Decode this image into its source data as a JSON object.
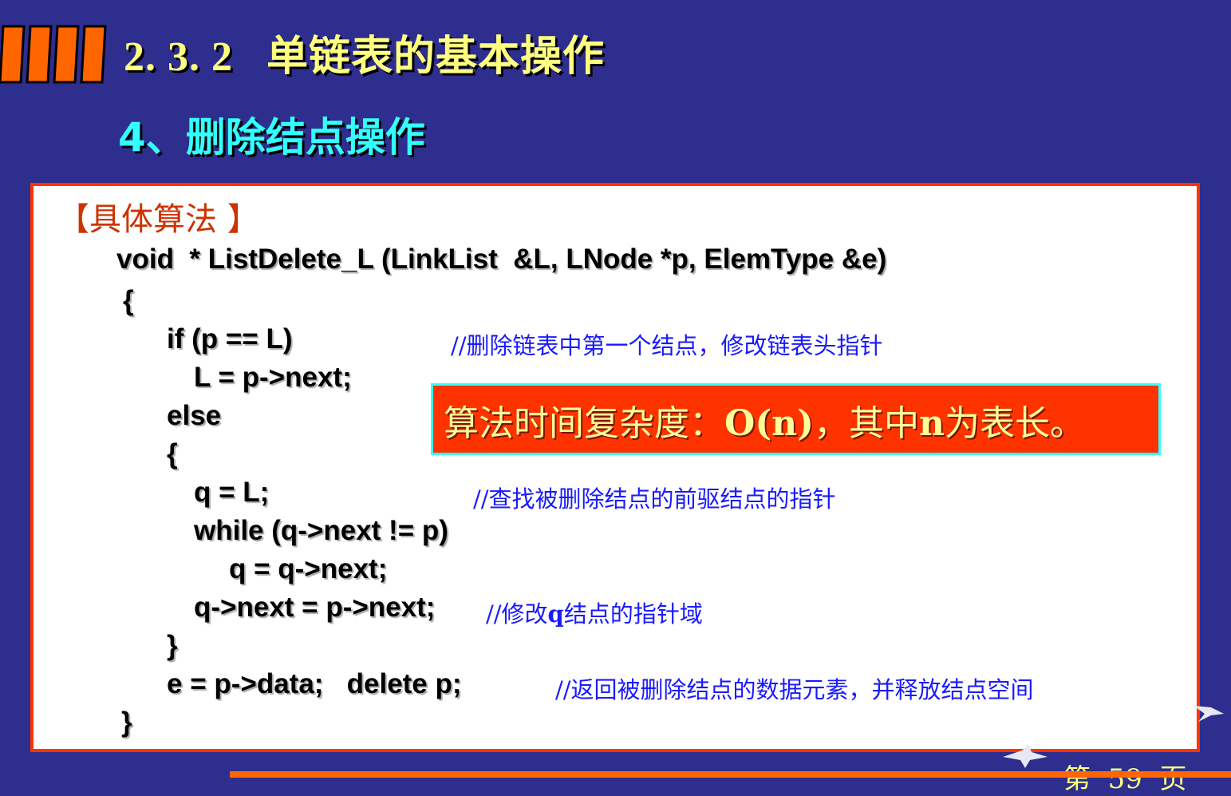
{
  "slide": {
    "title": "2. 3. 2   单链表的基本操作",
    "subtitle": "4、删除结点操作",
    "algorithm_label": "【具体算法 】",
    "code_lines": [
      "void  * ListDelete_L (LinkList  &L, LNode *p, ElemType &e)",
      "{",
      "if (p == L)",
      "L = p->next;",
      "else",
      "{",
      "q = L;",
      "while (q->next != p)",
      "q = q->next;",
      "q->next = p->next;",
      "}",
      "e = p->data;   delete p;",
      "}"
    ],
    "comments": {
      "delete_first": "//删除链表中第一个结点，修改链表头指针",
      "find_prev": "//查找被删除结点的前驱结点的指针",
      "modify_q_prefix": "//修改",
      "modify_q_var": "q",
      "modify_q_suffix": "结点的指针域",
      "return_free": "//返回被删除结点的数据元素，并释放结点空间"
    },
    "complexity": {
      "prefix": "算法时间复杂度：",
      "order": "O(n)",
      "middle": "，其中",
      "var": "n",
      "suffix": "为表长。"
    },
    "page_label": "第  59  页"
  },
  "colors": {
    "background": "#2e2e8e",
    "title": "#ffff80",
    "subtitle": "#33ffff",
    "panel_border": "#ff3300",
    "algorithm_label": "#cc3300",
    "comment": "#1a1aff",
    "callout_bg": "#ff3300",
    "callout_border": "#33ffff",
    "callout_text": "#ffff99",
    "stripes": "#ff6600"
  }
}
